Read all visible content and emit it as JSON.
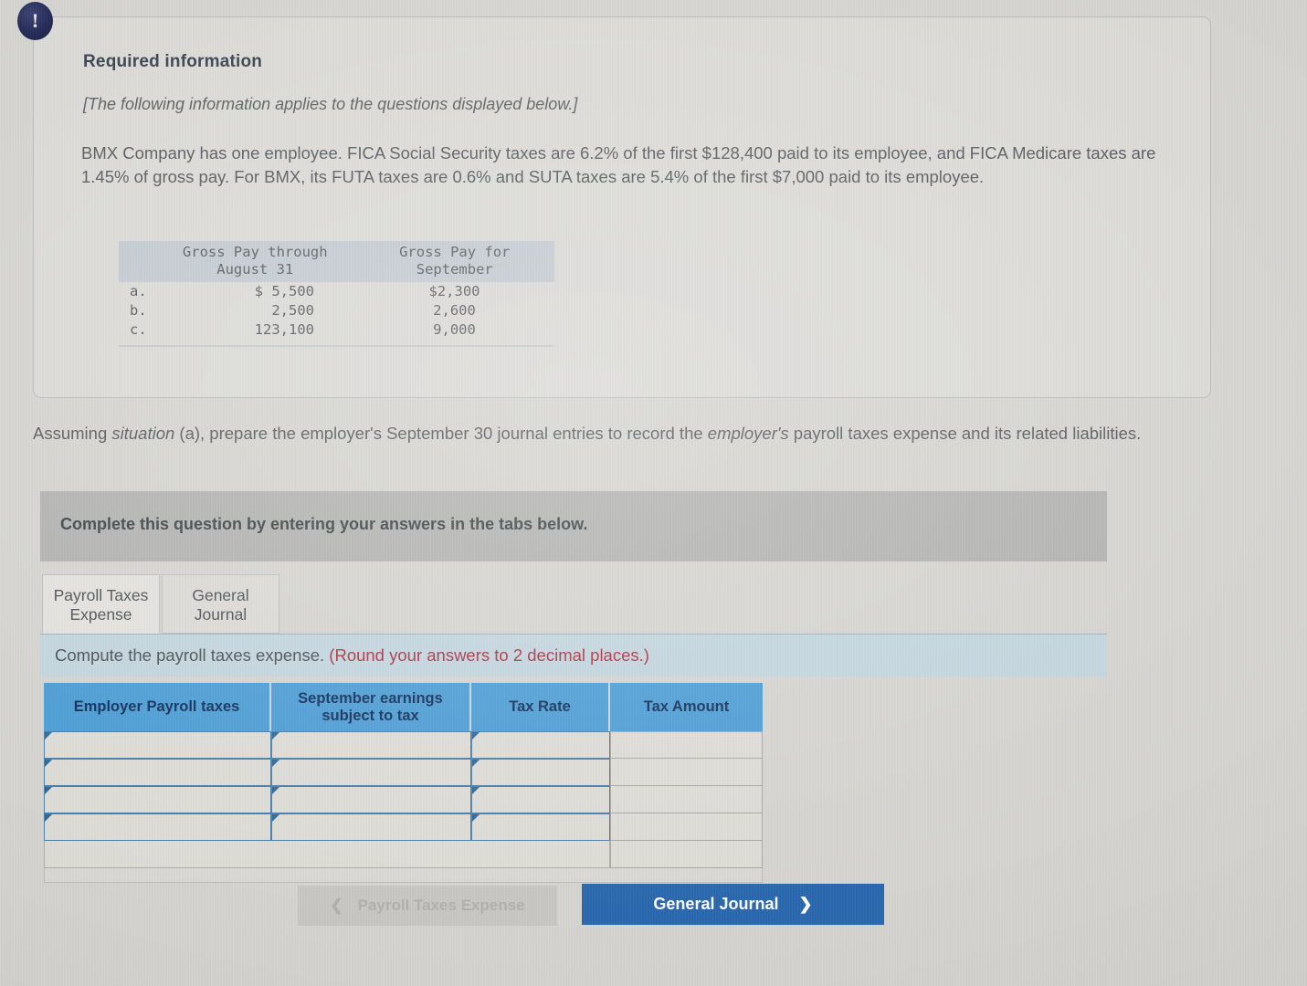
{
  "alert": {
    "icon": "exclamation-icon",
    "glyph": "!"
  },
  "required_info": {
    "title": "Required information",
    "subtitle": "[The following information applies to the questions displayed below.]",
    "body": "BMX Company has one employee. FICA Social Security taxes are 6.2% of the first $128,400 paid to its employee, and FICA Medicare taxes are 1.45% of gross pay. For BMX, its FUTA taxes are 0.6% and SUTA taxes are 5.4% of the first $7,000 paid to its employee."
  },
  "data_table": {
    "headers": [
      "Gross Pay through\nAugust 31",
      "Gross Pay for\nSeptember"
    ],
    "header_line1_col1": "Gross Pay through",
    "header_line2_col1": "August 31",
    "header_line1_col2": "Gross Pay for",
    "header_line2_col2": "September",
    "rows": [
      {
        "label": "a.",
        "through_august": "$  5,500",
        "september": "$2,300"
      },
      {
        "label": "b.",
        "through_august": "2,500",
        "september": "2,600"
      },
      {
        "label": "c.",
        "through_august": "123,100",
        "september": "9,000"
      }
    ]
  },
  "question": {
    "line1_a": "Assuming ",
    "line1_b": "situation",
    "line1_c": " (a), prepare the employer's September 30 journal entries to record the ",
    "line1_d": "employer's",
    "line1_e": " payroll taxes expense and its related liabilities."
  },
  "banner": {
    "text": "Complete this question by entering your answers in the tabs below."
  },
  "tabs": [
    {
      "id": "payroll-taxes-expense",
      "line1": "Payroll Taxes",
      "line2": "Expense",
      "active": true
    },
    {
      "id": "general-journal",
      "line1": "General",
      "line2": "Journal",
      "active": false
    }
  ],
  "instruction": {
    "main": "Compute the payroll taxes expense.",
    "note": "(Round your answers to 2 decimal places.)"
  },
  "answer_grid": {
    "columns": [
      "Employer Payroll taxes",
      "September earnings subject to tax",
      "Tax Rate",
      "Tax Amount"
    ],
    "col0": "Employer Payroll taxes",
    "col1_line1": "September earnings",
    "col1_line2": "subject to tax",
    "col2": "Tax Rate",
    "col3": "Tax Amount",
    "rows": [
      {
        "tax": "",
        "earnings": "",
        "rate": "",
        "amount": ""
      },
      {
        "tax": "",
        "earnings": "",
        "rate": "",
        "amount": ""
      },
      {
        "tax": "",
        "earnings": "",
        "rate": "",
        "amount": ""
      },
      {
        "tax": "",
        "earnings": "",
        "rate": "",
        "amount": ""
      }
    ],
    "total_row": {
      "label": "",
      "amount": ""
    }
  },
  "nav": {
    "prev_label": "Payroll Taxes Expense",
    "prev_icon": "chevron-left-icon",
    "next_label": "General Journal",
    "next_icon": "chevron-right-icon",
    "prev_disabled": true
  },
  "colors": {
    "grid_header_blue": "#4d9ed5",
    "primary_button": "#2a68ae",
    "instruction_bar": "#c3d5de",
    "banner_gray": "#b3b3b1",
    "note_red": "#a8343e",
    "badge_navy": "#232a56"
  }
}
